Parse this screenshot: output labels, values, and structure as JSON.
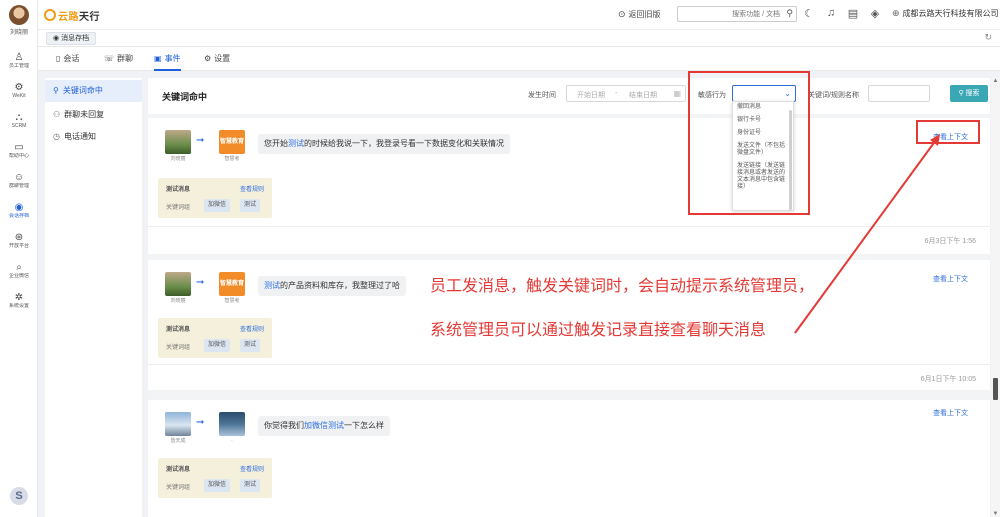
{
  "rail": {
    "user_name": "刘晓丽",
    "items": [
      {
        "label": "员工管理",
        "icon": "person-icon"
      },
      {
        "label": "WeKit",
        "icon": "gear-icon"
      },
      {
        "label": "SCRM",
        "icon": "network-icon"
      },
      {
        "label": "帮助中心",
        "icon": "chat-icon"
      },
      {
        "label": "群聊管理",
        "icon": "group-icon"
      },
      {
        "label": "会话存档",
        "icon": "archive-icon"
      },
      {
        "label": "开放平台",
        "icon": "platform-icon"
      },
      {
        "label": "企业微信",
        "icon": "search-icon"
      },
      {
        "label": "系统设置",
        "icon": "settings-icon"
      }
    ]
  },
  "header": {
    "logo_text_a": "云路",
    "logo_text_b": "天行",
    "return_label": "返回旧版",
    "search_placeholder": "搜索功能 / 文档",
    "company": "成都云路天行科技有限公司"
  },
  "tabstrip": {
    "tab_label": "消息存档"
  },
  "subtabs": [
    {
      "label": "会话",
      "icon": "chat-icon"
    },
    {
      "label": "群聊",
      "icon": "group-icon"
    },
    {
      "label": "事件",
      "icon": "monitor-icon"
    },
    {
      "label": "设置",
      "icon": "gear-icon"
    }
  ],
  "sidemenu": [
    {
      "label": "关键词命中",
      "icon": "search-icon"
    },
    {
      "label": "群聊未回复",
      "icon": "group-icon"
    },
    {
      "label": "电话通知",
      "icon": "phone-icon"
    }
  ],
  "main": {
    "title": "关键词命中",
    "filter_time_label": "发生时间",
    "date_start_placeholder": "开始日期",
    "date_sep": "-",
    "date_end_placeholder": "结束日期",
    "filter_behavior_label": "敏感行为",
    "filter_keyword_label": "关键词/规则名称",
    "search_button": "搜索"
  },
  "dropdown_options": [
    "撤回消息",
    "银行卡号",
    "身份证号",
    "发送文件（不包括微盘文件）",
    "发送链接（发送链接消息或者发送的文本消息中包含链接）"
  ],
  "records": [
    {
      "sender_name": "刘晓丽",
      "receiver_name": "智慧考",
      "brand_text": "智慧教育",
      "message_pre": "您开始",
      "message_hl": "测试",
      "message_post": "的时候给我说一下，我登录号看一下数据变化和关联情况",
      "view_context": "查看上下文",
      "trigger_title": "测试消息",
      "trigger_link": "查看规则",
      "trigger_label": "关键词组",
      "tags": [
        "加微信",
        "测试"
      ],
      "time": "6月3日下午 1:56"
    },
    {
      "sender_name": "刘晓丽",
      "receiver_name": "智慧考",
      "brand_text": "智慧教育",
      "message_pre": "",
      "message_hl": "测试",
      "message_post": "的产品资料和库存，我整理过了哈",
      "view_context": "查看上下文",
      "trigger_title": "测试消息",
      "trigger_link": "查看规则",
      "trigger_label": "关键词组",
      "tags": [
        "加微信",
        "测试"
      ],
      "time": "6月1日下午 10:05"
    },
    {
      "sender_name": "皆天成",
      "receiver_name": ".",
      "brand_text": "",
      "message_pre": "你觉得我们",
      "message_hl": "加微信测试",
      "message_post": "一下怎么样",
      "view_context": "查看上下文",
      "trigger_title": "测试消息",
      "trigger_link": "查看规则",
      "trigger_label": "关键词组",
      "tags": [
        "加微信",
        "测试"
      ],
      "time": ""
    }
  ],
  "annotation": {
    "line1": "员工发消息，触发关键词时，会自动提示系统管理员，",
    "line2": "系统管理员可以通过触发记录直接查看聊天消息",
    "color": "#e53935"
  }
}
